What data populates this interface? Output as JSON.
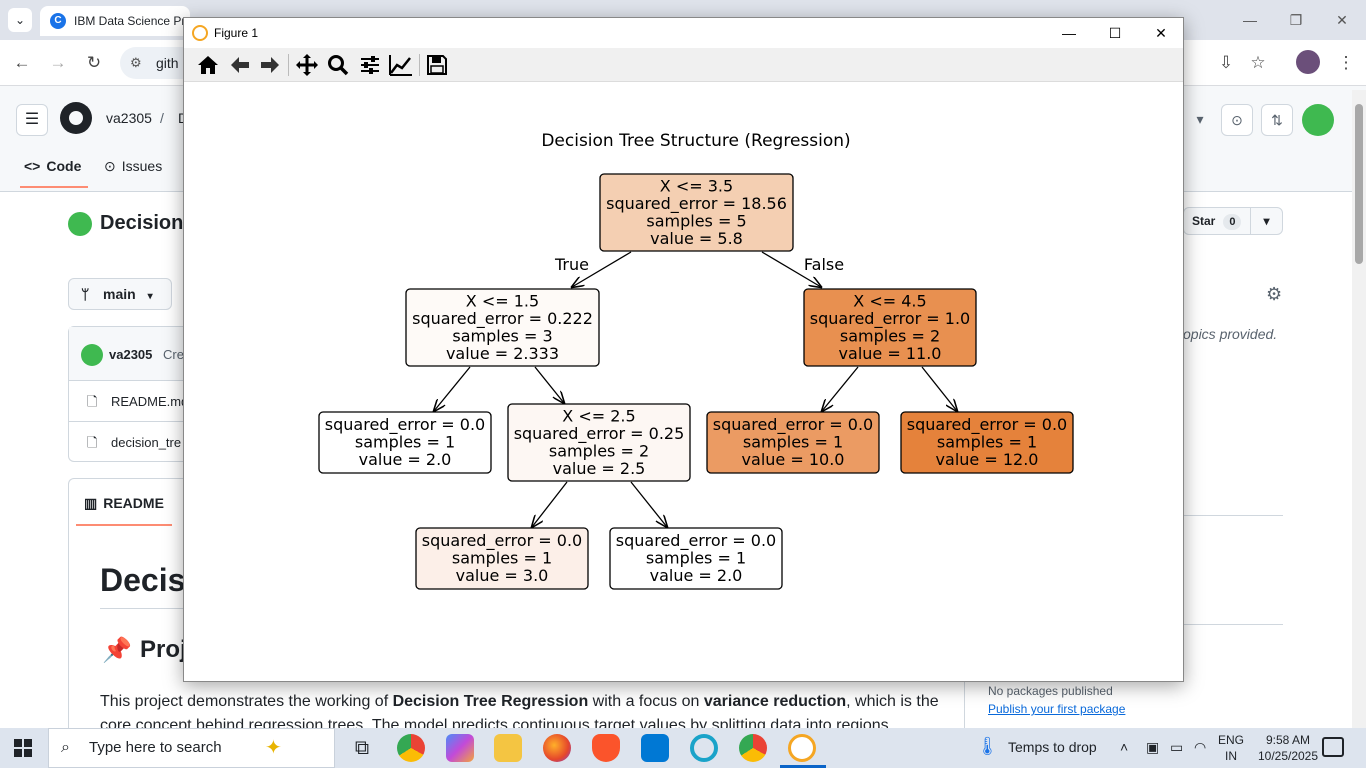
{
  "browser": {
    "active_tab_title": "IBM Data Science Pro",
    "omnibox_text": "gith"
  },
  "github": {
    "owner": "va2305",
    "slash": "/",
    "repo_partial": "D",
    "tabs": {
      "code": "Code",
      "issues": "Issues"
    },
    "repo_title": "DecisionT",
    "branch": "main",
    "commit_author": "va2305",
    "commit_partial": "Cre",
    "files": [
      "README.md",
      "decision_tre"
    ],
    "readme_tab": "README",
    "readme_h1": "Decisi",
    "readme_h2": "Proj",
    "readme_text_start": "This project demonstrates the working of ",
    "readme_bold1": "Decision Tree Regression",
    "readme_text_mid": " with a focus on ",
    "readme_bold2": "variance reduction",
    "readme_text_end": ", which is the core concept behind regression trees. The model predicts continuous target values by splitting data into regions",
    "star_label": "Star",
    "star_count": "0",
    "about_partial": "opics provided.",
    "packages_text": "No packages published",
    "packages_link": "Publish your first package"
  },
  "figure": {
    "window_title": "Figure 1",
    "toolbar": [
      "home-icon",
      "back-arrow-icon",
      "forward-arrow-icon",
      "pan-icon",
      "zoom-icon",
      "configure-subplots-icon",
      "edit-axis-icon",
      "save-icon"
    ]
  },
  "tree": {
    "title": "Decision Tree Structure (Regression)",
    "edge_true": "True",
    "edge_false": "False",
    "nodes": [
      {
        "id": "root",
        "lines": [
          "X <= 3.5",
          "squared_error = 18.56",
          "samples = 5",
          "value = 5.8"
        ],
        "fill": "#f4cfb2"
      },
      {
        "id": "left",
        "lines": [
          "X <= 1.5",
          "squared_error = 0.222",
          "samples = 3",
          "value = 2.333"
        ],
        "fill": "#fefaf7"
      },
      {
        "id": "right",
        "lines": [
          "X <= 4.5",
          "squared_error = 1.0",
          "samples = 2",
          "value = 11.0"
        ],
        "fill": "#e89050"
      },
      {
        "id": "ll",
        "lines": [
          "squared_error = 0.0",
          "samples = 1",
          "value = 2.0"
        ],
        "fill": "#ffffff"
      },
      {
        "id": "lr",
        "lines": [
          "X <= 2.5",
          "squared_error = 0.25",
          "samples = 2",
          "value = 2.5"
        ],
        "fill": "#fdf7f3"
      },
      {
        "id": "rl",
        "lines": [
          "squared_error = 0.0",
          "samples = 1",
          "value = 10.0"
        ],
        "fill": "#eb9b63"
      },
      {
        "id": "rr",
        "lines": [
          "squared_error = 0.0",
          "samples = 1",
          "value = 12.0"
        ],
        "fill": "#e5823b"
      },
      {
        "id": "lrl",
        "lines": [
          "squared_error = 0.0",
          "samples = 1",
          "value = 3.0"
        ],
        "fill": "#fcefe8"
      },
      {
        "id": "lrr",
        "lines": [
          "squared_error = 0.0",
          "samples = 1",
          "value = 2.0"
        ],
        "fill": "#ffffff"
      }
    ]
  },
  "taskbar": {
    "search_placeholder": "Type here to search",
    "weather": "Temps to drop",
    "lang_line1": "ENG",
    "lang_line2": "IN",
    "time": "9:58 AM",
    "date": "10/25/2025"
  }
}
